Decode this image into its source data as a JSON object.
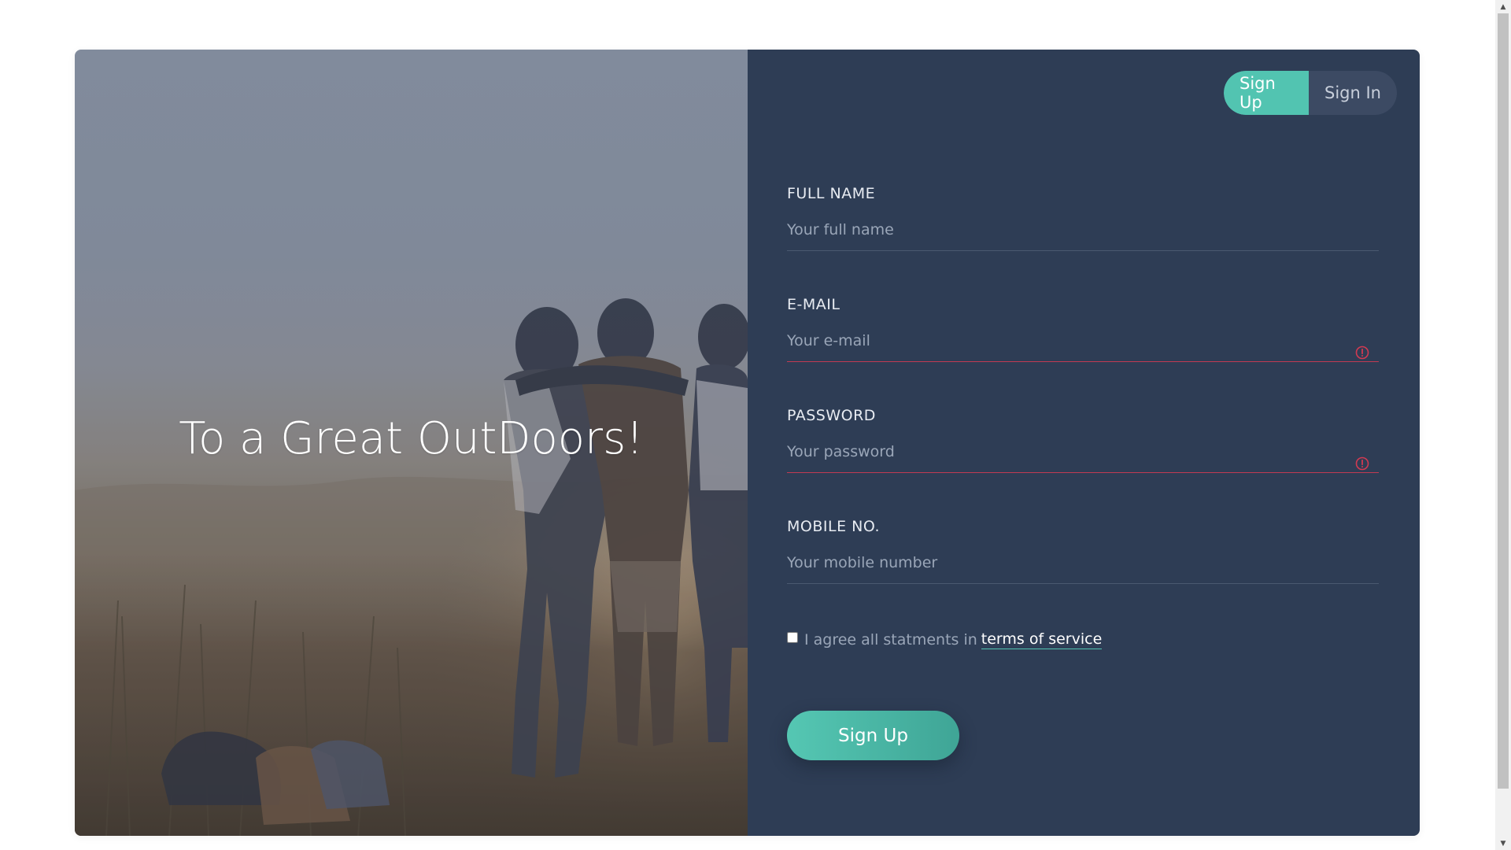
{
  "hero": {
    "title": "To a Great OutDoors!"
  },
  "switcher": {
    "sign_up_label": "Sign Up",
    "sign_in_label": "Sign In",
    "active": "Sign Up"
  },
  "form": {
    "full_name": {
      "label": "FULL NAME",
      "placeholder": "Your full name",
      "value": ""
    },
    "email": {
      "label": "E-MAIL",
      "placeholder": "Your e-mail",
      "value": "",
      "error": true
    },
    "password": {
      "label": "PASSWORD",
      "placeholder": "Your password",
      "value": "",
      "error": true
    },
    "mobile": {
      "label": "MOBILE NO.",
      "placeholder": "Your mobile number",
      "value": ""
    },
    "terms": {
      "checked": false,
      "text": "I agree all statments in",
      "link_text": "terms of service"
    },
    "submit_label": "Sign Up"
  },
  "colors": {
    "accent": "#52c4b1",
    "panel": "#2e3d55",
    "error": "#c13a52"
  },
  "icons": {
    "error": "exclamation-circle-icon",
    "scroll_up": "triangle-up",
    "scroll_down": "triangle-down"
  }
}
